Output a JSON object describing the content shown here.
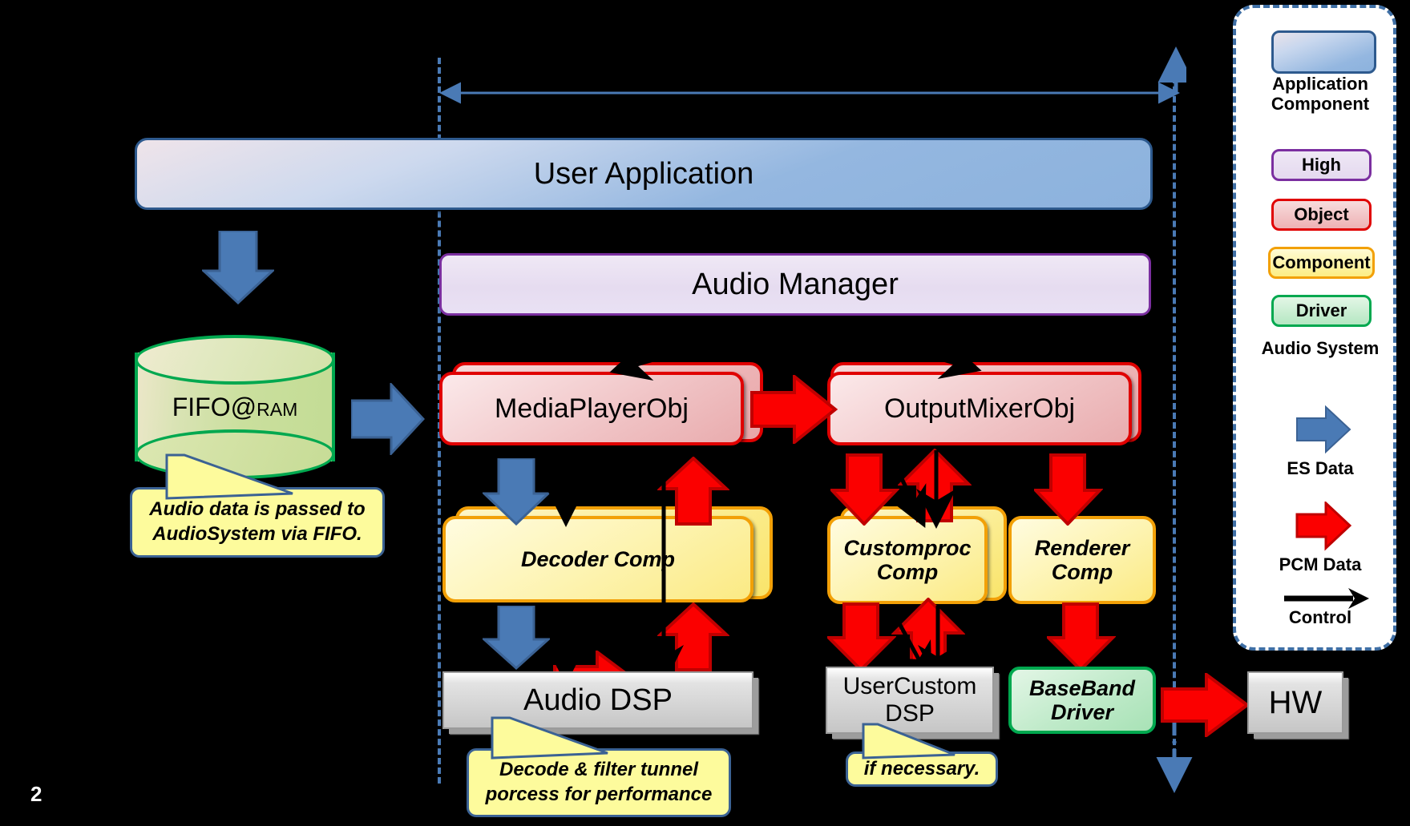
{
  "page": {
    "number": "2",
    "background": "#000000"
  },
  "top_layer": {
    "user_application": "User Application",
    "audio_manager": "Audio Manager"
  },
  "left_column": {
    "fifo": "FIFO@RAM",
    "fifo_suffix": "RAM",
    "callout": "Audio data is passed to AudioSystem via FIFO."
  },
  "objects": [
    {
      "name": "MediaPlayerObj"
    },
    {
      "name": "OutputMixerObj"
    }
  ],
  "components": [
    {
      "name": "Decoder Comp"
    },
    {
      "name": "Customproc Comp"
    },
    {
      "name": "Renderer Comp"
    }
  ],
  "drivers": [
    {
      "name": "BaseBand Driver"
    }
  ],
  "hardware": [
    {
      "name": "Audio DSP"
    },
    {
      "name": "UserCustom DSP"
    },
    {
      "name": "HW"
    }
  ],
  "callouts": [
    {
      "text": "Decode & filter tunnel porcess for performance"
    },
    {
      "text": "if necessary."
    }
  ],
  "legend": {
    "app_label": "Application Component",
    "chips": [
      {
        "label": "High",
        "color": "#7b2fa0"
      },
      {
        "label": "Object",
        "color": "#e00000"
      },
      {
        "label": "Component",
        "color": "#f2a007"
      },
      {
        "label": "Driver",
        "color": "#00a84f"
      }
    ],
    "system_label": "Audio System",
    "arrows": [
      {
        "label": "ES Data",
        "color": "#4a7ab5",
        "kind": "block-arrow"
      },
      {
        "label": "PCM Data",
        "color": "#ee0000",
        "kind": "block-arrow"
      },
      {
        "label": "Control",
        "color": "#000000",
        "kind": "line-arrow"
      }
    ]
  },
  "colors": {
    "es_data": "#4a7ab5",
    "pcm_data": "#ee0000",
    "boundary_dash": "#4a7ab5",
    "object_border": "#e00000",
    "component_border": "#f2a007",
    "driver_border": "#00a84f",
    "high_border": "#7b2fa0",
    "app_border": "#2e5a8e"
  }
}
